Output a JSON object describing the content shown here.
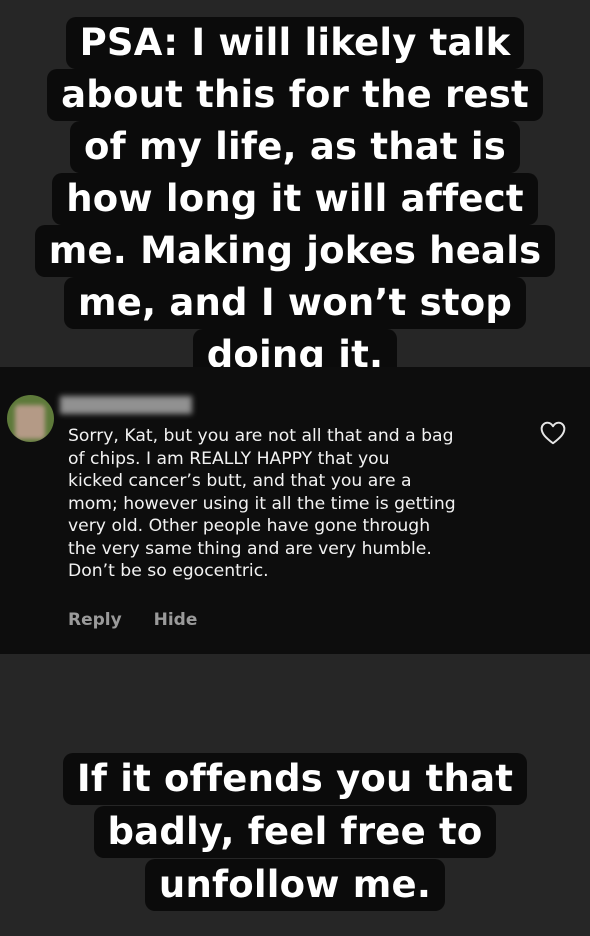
{
  "story": {
    "top_caption_lines": [
      "PSA: I will likely talk",
      "about this for the rest",
      "of my life, as that is",
      "how long it will affect",
      "me. Making jokes heals",
      "me, and I won’t stop",
      "doing it."
    ],
    "bottom_caption_lines": [
      "If it offends you that",
      "badly, feel free to",
      "unfollow me."
    ]
  },
  "comment": {
    "username": "",
    "text_lines": [
      "Sorry, Kat, but you are not all that and a bag",
      "of chips. I am REALLY HAPPY that you",
      "kicked cancer’s butt, and that you are a",
      "mom; however using it all the time is getting",
      "very old. Other people have gone through",
      "the very same thing and are very humble.",
      "Don’t be so egocentric."
    ],
    "reply_label": "Reply",
    "hide_label": "Hide",
    "like_icon": "heart-icon"
  },
  "colors": {
    "background": "#262626",
    "caption_background": "#0b0b0b",
    "caption_text": "#ffffff",
    "comment_background": "#0d0d0d",
    "comment_text": "#f2f2f2",
    "action_text": "#9a9a9a"
  }
}
